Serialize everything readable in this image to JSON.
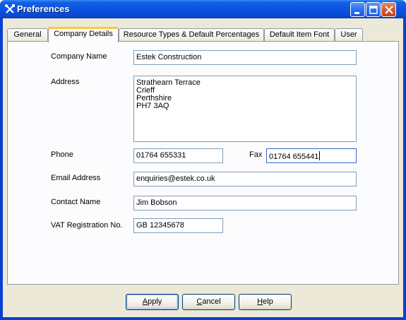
{
  "window": {
    "title": "Preferences"
  },
  "tabs": [
    {
      "label": "General"
    },
    {
      "label": "Company Details"
    },
    {
      "label": "Resource Types & Default Percentages"
    },
    {
      "label": "Default Item Font"
    },
    {
      "label": "User"
    }
  ],
  "active_tab": "Company Details",
  "form": {
    "company_name": {
      "label": "Company Name",
      "value": "Estek Construction"
    },
    "address": {
      "label": "Address",
      "lines": [
        "Strathearn Terrace",
        "Crieff",
        "Perthshire",
        "PH7 3AQ"
      ]
    },
    "phone": {
      "label": "Phone",
      "value": "01764 655331"
    },
    "fax": {
      "label": "Fax",
      "value": "01764 655441"
    },
    "email": {
      "label": "Email Address",
      "value": "enquiries@estek.co.uk"
    },
    "contact_name": {
      "label": "Contact Name",
      "value": "Jim Bobson"
    },
    "vat": {
      "label": "VAT Registration No.",
      "value": "GB 12345678"
    }
  },
  "buttons": {
    "apply": {
      "label": "Apply",
      "mnemonic_index": 0
    },
    "cancel": {
      "label": "Cancel",
      "mnemonic_index": 0
    },
    "help": {
      "label": "Help",
      "mnemonic_index": 0
    }
  },
  "icons": {
    "app": "tools-icon",
    "minimize": "minimize-icon",
    "maximize": "maximize-icon",
    "close": "close-icon"
  },
  "colors": {
    "titlebar": "#0a55e1",
    "close_button": "#d6582f",
    "active_tab_accent": "#ffc73c",
    "dialog_bg": "#ece9d8"
  }
}
